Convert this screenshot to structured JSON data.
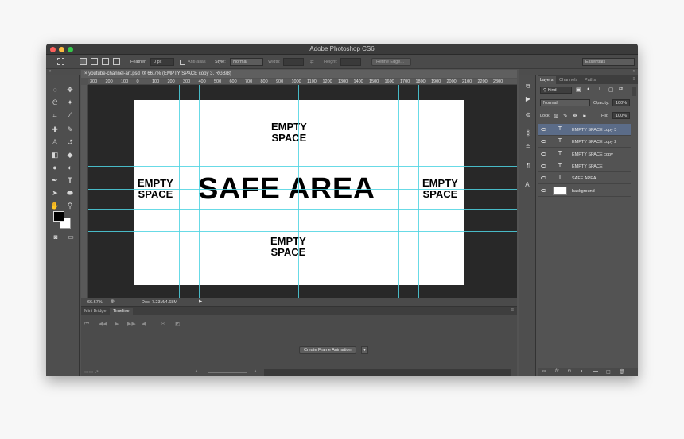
{
  "window": {
    "title": "Adobe Photoshop CS6"
  },
  "options_bar": {
    "feather_label": "Feather:",
    "feather_value": "0 px",
    "antialias_label": "Anti-alias",
    "style_label": "Style:",
    "style_value": "Normal",
    "width_label": "Width:",
    "height_label": "Height:",
    "refine_edge": "Refine Edge...",
    "workspace": "Essentials"
  },
  "document": {
    "tab_title": "youtube-channel-art.psd @ 66.7% (EMPTY SPACE copy 3, RGB/8)",
    "zoom": "66.67%",
    "doc_size": "Doc: 7.23M/4.68M"
  },
  "ruler_ticks": [
    "300",
    "200",
    "100",
    "0",
    "100",
    "200",
    "300",
    "400",
    "500",
    "600",
    "700",
    "800",
    "900",
    "1000",
    "1100",
    "1200",
    "1300",
    "1400",
    "1500",
    "1600",
    "1700",
    "1800",
    "1900",
    "2000",
    "2100",
    "2200",
    "2300"
  ],
  "canvas_text": {
    "top": "EMPTY\nSPACE",
    "left": "EMPTY\nSPACE",
    "center": "SAFE AREA",
    "right": "EMPTY\nSPACE",
    "bottom": "EMPTY\nSPACE"
  },
  "timeline_panel": {
    "tab_mini_bridge": "Mini Bridge",
    "tab_timeline": "Timeline",
    "create_button": "Create Frame Animation"
  },
  "layers_panel": {
    "tabs": [
      "Layers",
      "Channels",
      "Paths"
    ],
    "filter_kind": "Kind",
    "blend_mode": "Normal",
    "opacity_label": "Opacity:",
    "opacity_value": "100%",
    "lock_label": "Lock:",
    "fill_label": "Fill:",
    "fill_value": "100%",
    "layers": [
      {
        "name": "EMPTY SPACE copy 3",
        "type": "text",
        "selected": true
      },
      {
        "name": "EMPTY SPACE copy 2",
        "type": "text",
        "selected": false
      },
      {
        "name": "EMPTY SPACE copy",
        "type": "text",
        "selected": false
      },
      {
        "name": "EMPTY SPACE",
        "type": "text",
        "selected": false
      },
      {
        "name": "SAFE AREA",
        "type": "text",
        "selected": false
      },
      {
        "name": "background",
        "type": "image",
        "selected": false
      }
    ]
  },
  "colors": {
    "guide": "#4ed4e2",
    "selected_layer": "#5b6c88",
    "ui_background": "#535353"
  }
}
